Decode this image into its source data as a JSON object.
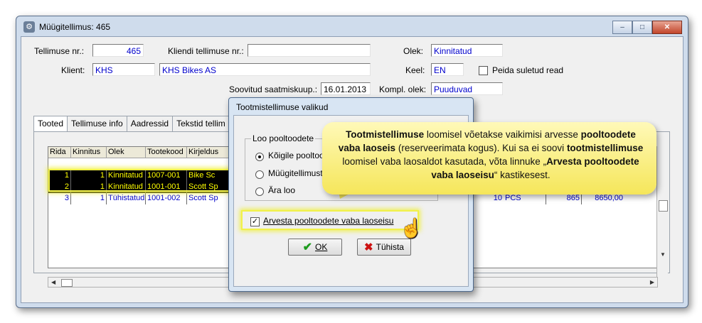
{
  "window": {
    "title": "Müügitellimus: 465",
    "buttons": {
      "minimize": "–",
      "maximize": "□",
      "close": "✕"
    }
  },
  "header": {
    "tellimuse_nr_label": "Tellimuse nr.:",
    "tellimuse_nr_value": "465",
    "kliendi_tellimuse_label": "Kliendi tellimuse nr.:",
    "kliendi_tellimuse_value": "",
    "olek_label": "Olek:",
    "olek_value": "Kinnitatud",
    "klient_label": "Klient:",
    "klient_code": "KHS",
    "klient_name": "KHS Bikes AS",
    "keel_label": "Keel:",
    "keel_value": "EN",
    "peida_label": "Peida suletud read",
    "soovitud_label": "Soovitud saatmiskuup.:",
    "soovitud_value": "16.01.2013",
    "kompl_label": "Kompl. olek:",
    "kompl_value": "Puuduvad"
  },
  "tabs": [
    "Tooted",
    "Tellimuse info",
    "Aadressid",
    "Tekstid tellim"
  ],
  "grid": {
    "headers": [
      "Rida",
      "Kinnitus",
      "Olek",
      "Tootekood",
      "Kirjeldus"
    ],
    "rows": [
      {
        "rida": "1",
        "kinnitus": "1",
        "olek": "Kinnitatud",
        "kood": "1007-001",
        "kirjeldus": "Bike Sc"
      },
      {
        "rida": "2",
        "kinnitus": "1",
        "olek": "Kinnitatud",
        "kood": "1001-001",
        "kirjeldus": "Scott Sp"
      },
      {
        "rida": "3",
        "kinnitus": "1",
        "olek": "Tühistatud",
        "kood": "1001-002",
        "kirjeldus": "Scott Sp",
        "kogus": "10",
        "uhik": "PCS",
        "hind": "865",
        "summa": "8650,00"
      }
    ]
  },
  "dialog": {
    "title": "Tootmistellimuse valikud",
    "group_label": "Loo pooltoodete",
    "options": [
      "Kõigile pooltoo",
      "Müügitellimust",
      "Ära loo"
    ],
    "checkbox_label": "Arvesta pooltoodete vaba laoseisu",
    "ok_label": "OK",
    "cancel_label": "Tühista"
  },
  "callout": {
    "p1_bold": "Tootmistellimuse",
    "p1_rest": " loomisel võetakse vaikimisi arvesse ",
    "p2_bold": "pooltoodete vaba laoseis",
    "p2_rest": " (reserveerimata kogus).  Kui sa ei soovi ",
    "p3_bold": "tootmistellimuse",
    "p3_rest": " loomisel vaba laosaldot kasutada, võta linnuke „",
    "p4_bold": "Arvesta pooltoodete vaba laoseisu",
    "p4_rest": "“ kastikesest."
  },
  "colors": {
    "accent_blue": "#0000cc",
    "highlight_yellow": "#f1f14a",
    "selected_row_bg": "#000000",
    "selected_row_fg": "#ffff00"
  }
}
